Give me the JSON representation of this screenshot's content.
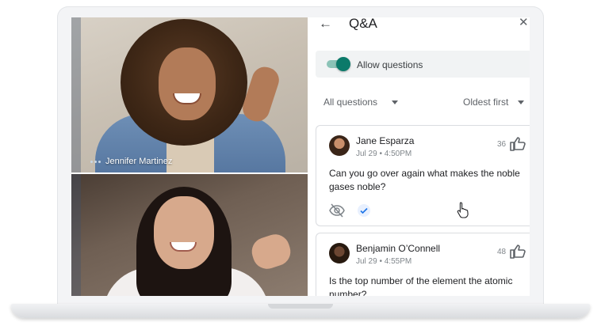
{
  "video": {
    "participant_top_name": "Jennifer Martinez"
  },
  "qa": {
    "title": "Q&A",
    "back_icon": "←",
    "close_icon": "✕",
    "allow_questions_label": "Allow questions",
    "allow_questions_enabled": true,
    "filter_label": "All questions",
    "sort_label": "Oldest first",
    "questions": [
      {
        "author": "Jane Esparza",
        "meta": "Jul 29 • 4:50PM",
        "votes": "36",
        "text": "Can you go over again what makes the noble gases noble?"
      },
      {
        "author": "Benjamin O’Connell",
        "meta": "Jul 29 • 4:55PM",
        "votes": "48",
        "text": "Is the top number of the element the atomic number?"
      }
    ]
  },
  "colors": {
    "toggle_on": "#0b7a6a",
    "card_border": "#dadce0",
    "allow_bar_bg": "#f1f3f4"
  },
  "icons": [
    "back-arrow-icon",
    "close-icon",
    "toggle-icon",
    "chevron-down-icon",
    "thumbs-up-icon",
    "hide-icon",
    "check-icon",
    "cursor-hand-icon"
  ]
}
